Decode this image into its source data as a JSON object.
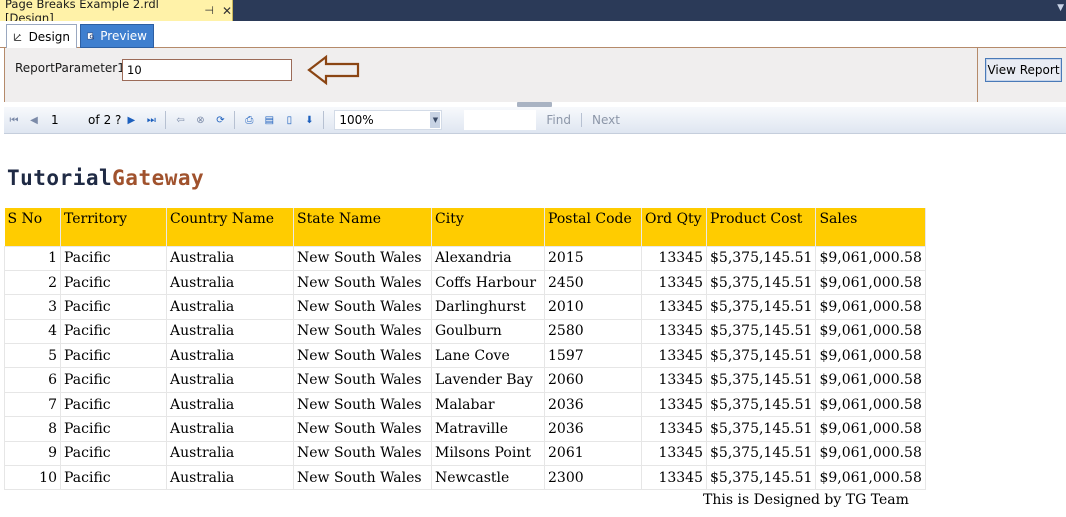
{
  "window": {
    "doc_tab_title": "Page Breaks Example 2.rdl [Design]",
    "pin_icon": "pin-icon",
    "close_icon": "close-icon"
  },
  "mode_tabs": {
    "design_label": "Design",
    "preview_label": "Preview",
    "active": "preview"
  },
  "parameters": {
    "label": "ReportParameter1",
    "value": "10",
    "view_report_label": "View Report"
  },
  "toolbar": {
    "current_page": "1",
    "of_label": "of",
    "total_pages": "2 ?",
    "zoom": "100%",
    "find_label": "Find",
    "next_label": "Next"
  },
  "report": {
    "logo_part1": "Tutorial",
    "logo_part2": "Gateway",
    "columns": [
      "S No",
      "Territory",
      "Country Name",
      "State Name",
      "City",
      "Postal Code",
      "Ord Qty",
      "Product Cost",
      "Sales"
    ],
    "rows": [
      [
        "1",
        "Pacific",
        "Australia",
        "New South Wales",
        "Alexandria",
        "2015",
        "13345",
        "$5,375,145.51",
        "$9,061,000.58"
      ],
      [
        "2",
        "Pacific",
        "Australia",
        "New South Wales",
        "Coffs Harbour",
        "2450",
        "13345",
        "$5,375,145.51",
        "$9,061,000.58"
      ],
      [
        "3",
        "Pacific",
        "Australia",
        "New South Wales",
        "Darlinghurst",
        "2010",
        "13345",
        "$5,375,145.51",
        "$9,061,000.58"
      ],
      [
        "4",
        "Pacific",
        "Australia",
        "New South Wales",
        "Goulburn",
        "2580",
        "13345",
        "$5,375,145.51",
        "$9,061,000.58"
      ],
      [
        "5",
        "Pacific",
        "Australia",
        "New South Wales",
        "Lane Cove",
        "1597",
        "13345",
        "$5,375,145.51",
        "$9,061,000.58"
      ],
      [
        "6",
        "Pacific",
        "Australia",
        "New South Wales",
        "Lavender Bay",
        "2060",
        "13345",
        "$5,375,145.51",
        "$9,061,000.58"
      ],
      [
        "7",
        "Pacific",
        "Australia",
        "New South Wales",
        "Malabar",
        "2036",
        "13345",
        "$5,375,145.51",
        "$9,061,000.58"
      ],
      [
        "8",
        "Pacific",
        "Australia",
        "New South Wales",
        "Matraville",
        "2036",
        "13345",
        "$5,375,145.51",
        "$9,061,000.58"
      ],
      [
        "9",
        "Pacific",
        "Australia",
        "New South Wales",
        "Milsons Point",
        "2061",
        "13345",
        "$5,375,145.51",
        "$9,061,000.58"
      ],
      [
        "10",
        "Pacific",
        "Australia",
        "New South Wales",
        "Newcastle",
        "2300",
        "13345",
        "$5,375,145.51",
        "$9,061,000.58"
      ]
    ],
    "footer_note": "This is Designed by TG Team"
  },
  "colors": {
    "header_fill": "#ffcc00",
    "logo_dark": "#1f2a44",
    "logo_accent": "#a0522d",
    "preview_tab": "#3f7fcf",
    "doc_tab": "#fff2a8"
  }
}
